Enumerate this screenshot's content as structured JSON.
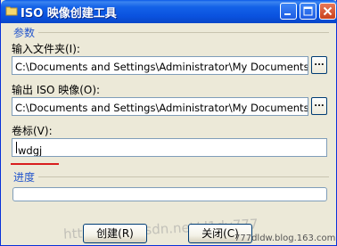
{
  "window": {
    "title": "ISO 映像创建工具",
    "icon": "folder-icon"
  },
  "params": {
    "group_title": "参数",
    "input_folder_label": "输入文件夹(I):",
    "input_folder_value": "C:\\Documents and Settings\\Administrator\\My Documents\\新建文件夹",
    "output_iso_label": "输出 ISO 映像(O):",
    "output_iso_value": "C:\\Documents and Settings\\Administrator\\My Documents\\新建文件夹",
    "volume_label": "卷标(V):",
    "volume_value": "wdgj",
    "browse_label": "..."
  },
  "progress": {
    "group_title": "进度",
    "value": 0
  },
  "buttons": {
    "create": "创建(R)",
    "close": "关闭(C)"
  },
  "watermark": {
    "text": "http://blog.csdn.net/d1dy777",
    "text2": "777dldw.blog.163.com"
  },
  "colors": {
    "titlebar": "#0a52df",
    "group_title": "#2255cc",
    "accent_line": "#d81e1e"
  }
}
